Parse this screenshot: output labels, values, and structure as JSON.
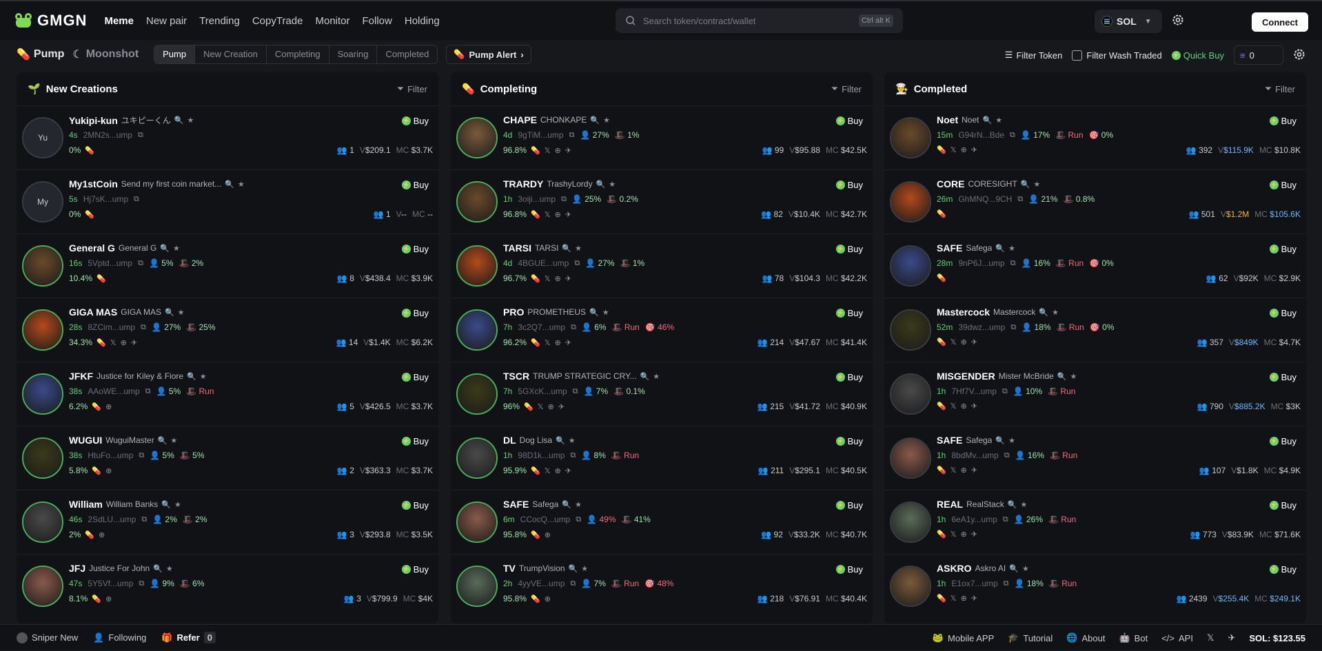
{
  "app": {
    "logo": "GMGN"
  },
  "nav": [
    "Meme",
    "New pair",
    "Trending",
    "CopyTrade",
    "Monitor",
    "Follow",
    "Holding"
  ],
  "search": {
    "placeholder": "Search token/contract/wallet",
    "shortcut": "Ctrl alt K"
  },
  "chain": {
    "label": "SOL"
  },
  "connect_label": "Connect",
  "subbar": {
    "brands": [
      "Pump",
      "Moonshot"
    ],
    "tabs": [
      "Pump",
      "New Creation",
      "Completing",
      "Soaring",
      "Completed"
    ],
    "alert": "Pump Alert",
    "filter_token": "Filter Token",
    "wash": "Filter Wash Traded",
    "quick_buy": "Quick Buy",
    "quick_amount": "0"
  },
  "columns": [
    {
      "title": "New Creations",
      "filter": "Filter",
      "rows": [
        {
          "sym": "Yukipi-kun",
          "full": "ユキピーくん",
          "age": "4s",
          "addr": "2MN2s...ump",
          "h": "",
          "d": "",
          "run": "",
          "tag": "",
          "prog": "0%",
          "holders": "1",
          "vol": "$209.1",
          "mc": "$3.7K",
          "init": "Yu"
        },
        {
          "sym": "My1stCoin",
          "full": "Send my first coin market...",
          "age": "5s",
          "addr": "Hj7sK...ump",
          "h": "",
          "d": "",
          "run": "",
          "tag": "",
          "prog": "0%",
          "holders": "1",
          "vol": "--",
          "mc": "--",
          "init": "My"
        },
        {
          "sym": "General G",
          "full": "General G",
          "age": "16s",
          "addr": "5Vptd...ump",
          "h": "5%",
          "d": "2%",
          "run": "",
          "tag": "",
          "prog": "10.4%",
          "holders": "8",
          "vol": "$438.4",
          "mc": "$3.9K",
          "init": ""
        },
        {
          "sym": "GIGA MAS",
          "full": "GIGA MAS",
          "age": "28s",
          "addr": "8ZCim...ump",
          "h": "27%",
          "d": "25%",
          "run": "",
          "tag": "",
          "prog": "34.3%",
          "holders": "14",
          "vol": "$1.4K",
          "mc": "$6.2K",
          "init": ""
        },
        {
          "sym": "JFKF",
          "full": "Justice for Kiley & Fiore",
          "age": "38s",
          "addr": "AAoWE...ump",
          "h": "5%",
          "d": "",
          "run": "Run",
          "tag": "",
          "prog": "6.2%",
          "holders": "5",
          "vol": "$426.5",
          "mc": "$3.7K",
          "init": ""
        },
        {
          "sym": "WUGUI",
          "full": "WuguiMaster",
          "age": "38s",
          "addr": "HtuFo...ump",
          "h": "5%",
          "d": "5%",
          "run": "",
          "tag": "",
          "prog": "5.8%",
          "holders": "2",
          "vol": "$363.3",
          "mc": "$3.7K",
          "init": ""
        },
        {
          "sym": "William",
          "full": "William Banks",
          "age": "46s",
          "addr": "2SdLU...ump",
          "h": "2%",
          "d": "2%",
          "run": "",
          "tag": "",
          "prog": "2%",
          "holders": "3",
          "vol": "$293.8",
          "mc": "$3.5K",
          "init": ""
        },
        {
          "sym": "JFJ",
          "full": "Justice For John",
          "age": "47s",
          "addr": "5Y5Vf...ump",
          "h": "9%",
          "d": "6%",
          "run": "",
          "tag": "",
          "prog": "8.1%",
          "holders": "3",
          "vol": "$799.9",
          "mc": "$4K",
          "init": ""
        }
      ]
    },
    {
      "title": "Completing",
      "filter": "Filter",
      "rows": [
        {
          "sym": "CHAPE",
          "full": "CHONKAPE",
          "age": "4d",
          "addr": "9gTiM...ump",
          "h": "27%",
          "d": "1%",
          "run": "",
          "tag": "",
          "prog": "96.8%",
          "holders": "99",
          "vol": "$95.88",
          "mc": "$42.5K",
          "init": ""
        },
        {
          "sym": "TRARDY",
          "full": "TrashyLordy",
          "age": "1h",
          "addr": "3oiji...ump",
          "h": "25%",
          "d": "0.2%",
          "run": "",
          "tag": "",
          "prog": "96.8%",
          "holders": "82",
          "vol": "$10.4K",
          "mc": "$42.7K",
          "init": ""
        },
        {
          "sym": "TARSI",
          "full": "TARSI",
          "age": "4d",
          "addr": "4BGUE...ump",
          "h": "27%",
          "d": "1%",
          "run": "",
          "tag": "",
          "prog": "96.7%",
          "holders": "78",
          "vol": "$104.3",
          "mc": "$42.2K",
          "init": ""
        },
        {
          "sym": "PRO",
          "full": "PROMETHEUS",
          "age": "7h",
          "addr": "3c2Q7...ump",
          "h": "6%",
          "d": "",
          "run": "Run",
          "tag": "46%",
          "prog": "96.2%",
          "holders": "214",
          "vol": "$47.67",
          "mc": "$41.4K",
          "init": ""
        },
        {
          "sym": "TSCR",
          "full": "TRUMP STRATEGIC CRY...",
          "age": "7h",
          "addr": "5GXcK...ump",
          "h": "7%",
          "d": "0.1%",
          "run": "",
          "tag": "",
          "prog": "96%",
          "holders": "215",
          "vol": "$41.72",
          "mc": "$40.9K",
          "init": ""
        },
        {
          "sym": "DL",
          "full": "Dog Lisa",
          "age": "1h",
          "addr": "98D1k...ump",
          "h": "8%",
          "d": "",
          "run": "Run",
          "tag": "",
          "prog": "95.9%",
          "holders": "211",
          "vol": "$295.1",
          "mc": "$40.5K",
          "init": ""
        },
        {
          "sym": "SAFE",
          "full": "Safega",
          "age": "6m",
          "addr": "CCocQ...ump",
          "h": "49%",
          "d": "41%",
          "run": "",
          "tag": "",
          "prog": "95.8%",
          "holders": "92",
          "vol": "$33.2K",
          "mc": "$40.7K",
          "init": ""
        },
        {
          "sym": "TV",
          "full": "TrumpVision",
          "age": "2h",
          "addr": "4yyVE...ump",
          "h": "7%",
          "d": "",
          "run": "Run",
          "tag": "48%",
          "prog": "95.8%",
          "holders": "218",
          "vol": "$76.91",
          "mc": "$40.4K",
          "init": ""
        }
      ]
    },
    {
      "title": "Completed",
      "filter": "Filter",
      "rows": [
        {
          "sym": "Noet",
          "full": "Noet",
          "age": "15m",
          "addr": "G94rN...Bde",
          "h": "17%",
          "d": "",
          "run": "Run",
          "tag": "0%",
          "prog": "",
          "holders": "392",
          "vol": "$115.9K",
          "mc": "$10.8K",
          "init": ""
        },
        {
          "sym": "CORE",
          "full": "CORESIGHT",
          "age": "26m",
          "addr": "GhMNQ...9CH",
          "h": "21%",
          "d": "0.8%",
          "run": "",
          "tag": "",
          "prog": "",
          "holders": "501",
          "vol": "$1.2M",
          "mc": "$105.6K",
          "init": ""
        },
        {
          "sym": "SAFE",
          "full": "Safega",
          "age": "28m",
          "addr": "9nP6J...ump",
          "h": "16%",
          "d": "",
          "run": "Run",
          "tag": "0%",
          "prog": "",
          "holders": "62",
          "vol": "$92K",
          "mc": "$2.9K",
          "init": ""
        },
        {
          "sym": "Mastercock",
          "full": "Mastercock",
          "age": "52m",
          "addr": "39dwz...ump",
          "h": "18%",
          "d": "",
          "run": "Run",
          "tag": "0%",
          "prog": "",
          "holders": "357",
          "vol": "$849K",
          "mc": "$4.7K",
          "init": ""
        },
        {
          "sym": "MISGENDER",
          "full": "Mister McBride",
          "age": "1h",
          "addr": "7Hf7V...ump",
          "h": "10%",
          "d": "",
          "run": "Run",
          "tag": "",
          "prog": "",
          "holders": "790",
          "vol": "$885.2K",
          "mc": "$3K",
          "init": ""
        },
        {
          "sym": "SAFE",
          "full": "Safega",
          "age": "1h",
          "addr": "8bdMv...ump",
          "h": "16%",
          "d": "",
          "run": "Run",
          "tag": "",
          "prog": "",
          "holders": "107",
          "vol": "$1.8K",
          "mc": "$4.9K",
          "init": ""
        },
        {
          "sym": "REAL",
          "full": "RealStack",
          "age": "1h",
          "addr": "6eA1y...ump",
          "h": "26%",
          "d": "",
          "run": "Run",
          "tag": "",
          "prog": "",
          "holders": "773",
          "vol": "$83.9K",
          "mc": "$71.6K",
          "init": ""
        },
        {
          "sym": "ASKRO",
          "full": "Askro AI",
          "age": "1h",
          "addr": "E1ox7...ump",
          "h": "18%",
          "d": "",
          "run": "Run",
          "tag": "",
          "prog": "",
          "holders": "2439",
          "vol": "$255.4K",
          "mc": "$249.1K",
          "init": ""
        }
      ]
    }
  ],
  "buy_label": "Buy",
  "footer": {
    "sniper": "Sniper New",
    "following": "Following",
    "refer": "Refer",
    "refer_count": "0",
    "mobile": "Mobile APP",
    "tutorial": "Tutorial",
    "about": "About",
    "bot": "Bot",
    "api": "API",
    "sol_price": "SOL: $123.55"
  },
  "colors": {
    "accent_green": "#5fd47c",
    "run_red": "#f26d7d",
    "vol_blue": "#6fb7ff",
    "vol_gold": "#f5b53d"
  }
}
